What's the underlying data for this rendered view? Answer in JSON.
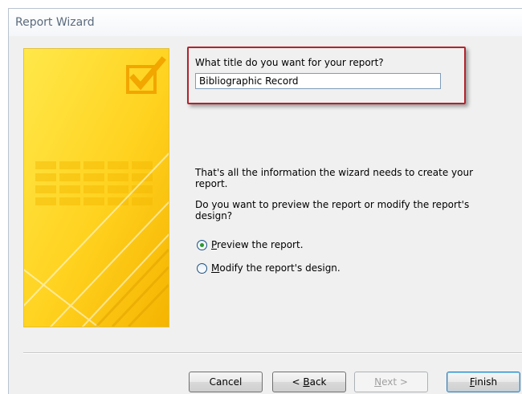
{
  "window": {
    "title": "Report Wizard"
  },
  "step": {
    "question": "What title do you want for your report?",
    "title_value": "Bibliographic Record",
    "info": "That's all the information the wizard needs to create your report.",
    "question2": "Do you want to preview the report or modify the report's design?"
  },
  "options": {
    "preview": {
      "accel": "P",
      "rest": "review the report.",
      "selected": true
    },
    "modify": {
      "accel": "M",
      "rest": "odify the report's design.",
      "selected": false
    }
  },
  "buttons": {
    "cancel": "Cancel",
    "back_prefix": "< ",
    "back_accel": "B",
    "back_rest": "ack",
    "next_accel": "N",
    "next_rest": "ext >",
    "finish_accel": "F",
    "finish_rest": "inish"
  },
  "colors": {
    "highlight": "#b0242e",
    "radio_dot": "#2b9a2b"
  },
  "icons": [
    "checkmark-icon",
    "radio-selected-icon",
    "radio-unselected-icon"
  ]
}
